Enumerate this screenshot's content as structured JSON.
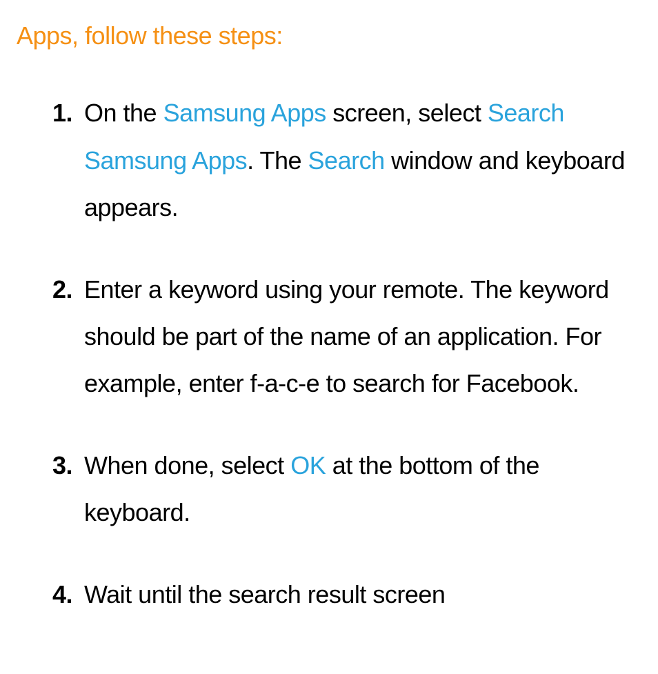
{
  "heading": "Apps, follow these steps:",
  "items": [
    {
      "num": "1.",
      "segments": [
        {
          "text": "On the "
        },
        {
          "text": "Samsung Apps",
          "hl": true
        },
        {
          "text": " screen, select "
        },
        {
          "text": "Search Samsung Apps",
          "hl": true
        },
        {
          "text": ". The "
        },
        {
          "text": "Search",
          "hl": true
        },
        {
          "text": " window and keyboard appears."
        }
      ]
    },
    {
      "num": "2.",
      "segments": [
        {
          "text": "Enter a keyword using your remote. The keyword should be part of the name of an application. For example, enter f-a-c-e to search for Facebook."
        }
      ]
    },
    {
      "num": "3.",
      "segments": [
        {
          "text": "When done, select "
        },
        {
          "text": "OK",
          "hl": true
        },
        {
          "text": " at the bottom of the keyboard."
        }
      ]
    },
    {
      "num": "4.",
      "segments": [
        {
          "text": "Wait until the search result screen"
        }
      ]
    }
  ]
}
